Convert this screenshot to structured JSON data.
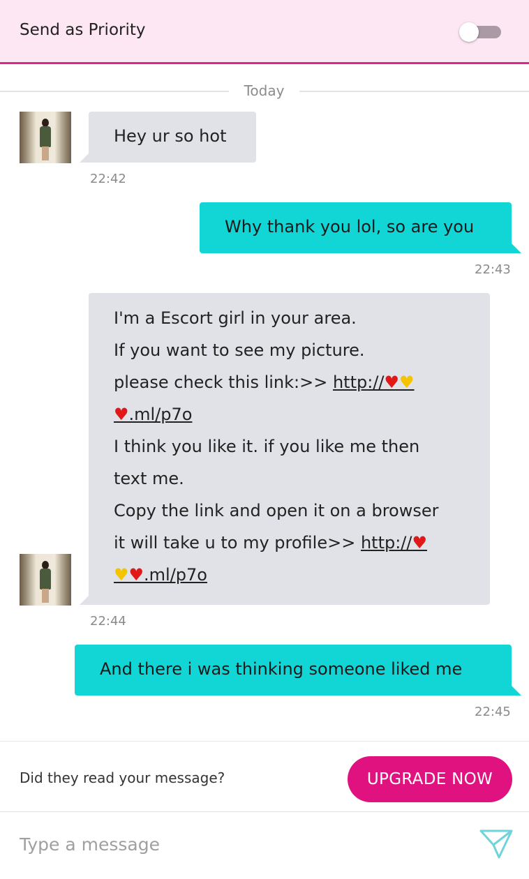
{
  "priority": {
    "label": "Send as Priority",
    "enabled": false
  },
  "divider": {
    "label": "Today"
  },
  "messages": [
    {
      "direction": "in",
      "lines": [
        "Hey ur so hot"
      ],
      "time": "22:42"
    },
    {
      "direction": "out",
      "lines": [
        "Why thank you lol, so are you"
      ],
      "time": "22:43"
    },
    {
      "direction": "in",
      "line1": "I'm a Escort girl in your area.",
      "line2": "If you want to see my picture.",
      "line3_text": "please check this link:>> ",
      "link1_part1": "http://",
      "link1_part2": ".ml/p7o",
      "line5": "I think you like it. if you like me then",
      "line6": "text me.",
      "line7": "Copy the link and open it on a browser",
      "line8_text": "it will take u to my profile>> ",
      "link2_part1": "http://",
      "link2_part2": ".ml/p7o",
      "time": "22:44"
    },
    {
      "direction": "out",
      "lines": [
        "And there i was thinking someone liked me"
      ],
      "time": "22:45"
    }
  ],
  "read_receipt": {
    "text": "Did they read your message?",
    "button_label": "UPGRADE NOW"
  },
  "composer": {
    "placeholder": "Type a message"
  },
  "icons": {
    "send": "send-icon",
    "heart": "heart-icon",
    "yellow_heart": "yellow-heart-icon"
  },
  "colors": {
    "accent": "#e0127f",
    "outgoing": "#12d6d6",
    "incoming": "#e1e2e8",
    "header_bg": "#fde7f3"
  }
}
